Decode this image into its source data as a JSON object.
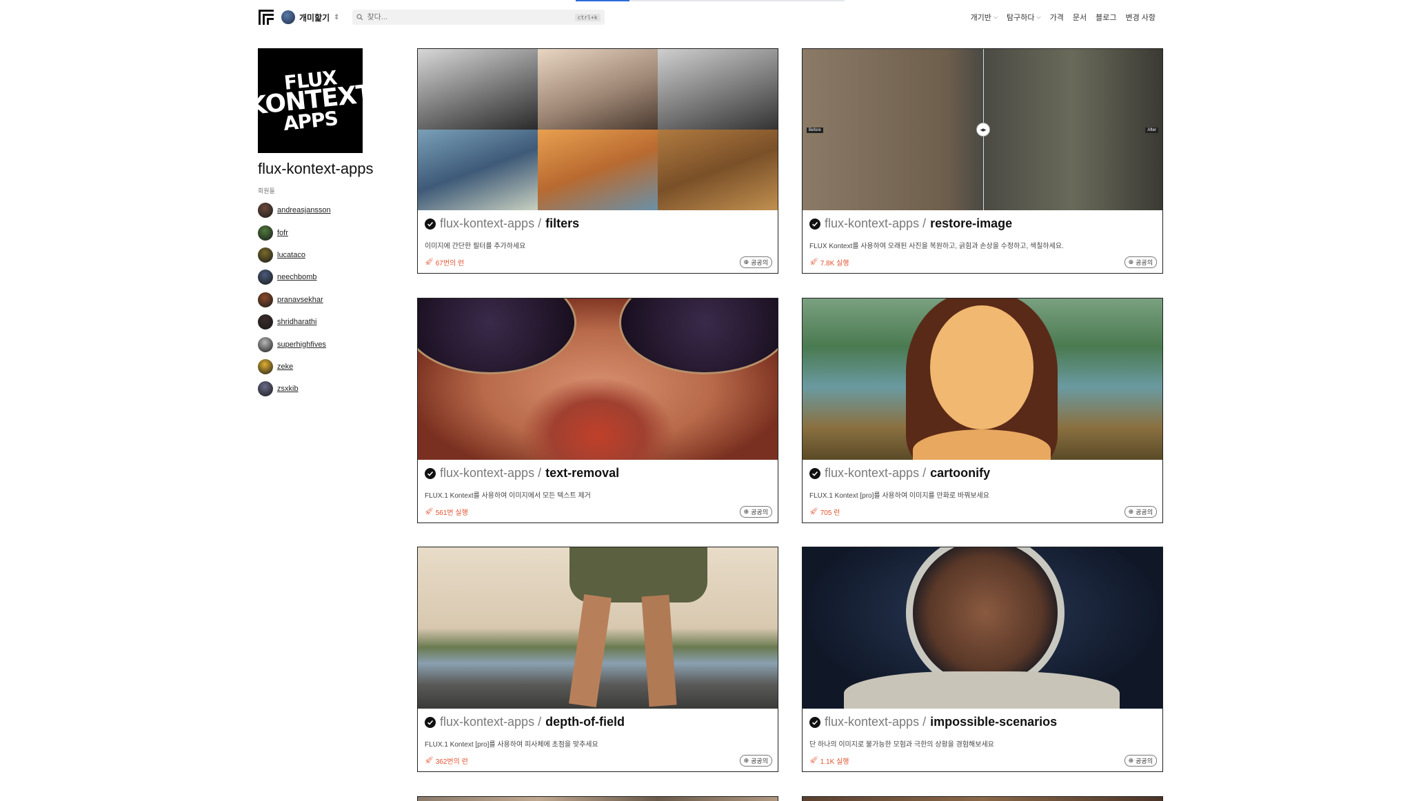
{
  "header": {
    "account_name": "개미핥기",
    "search_placeholder": "찾다...",
    "search_shortcut": "ctrl+k",
    "nav": [
      {
        "label": "개기반",
        "has_dropdown": true
      },
      {
        "label": "탐구하다",
        "has_dropdown": true
      },
      {
        "label": "가격",
        "has_dropdown": false
      },
      {
        "label": "문서",
        "has_dropdown": false
      },
      {
        "label": "블로그",
        "has_dropdown": false
      },
      {
        "label": "변경 사항",
        "has_dropdown": false
      }
    ]
  },
  "sidebar": {
    "logo_lines": [
      "FLUX",
      "KONTEXT",
      "APPS"
    ],
    "org_name": "flux-kontext-apps",
    "members_label": "회원들",
    "members": [
      {
        "name": "andreasjansson",
        "color": "#6b4a3a"
      },
      {
        "name": "fofr",
        "color": "#4f7a3c"
      },
      {
        "name": "lucataco",
        "color": "#7a6a2a"
      },
      {
        "name": "neechbomb",
        "color": "#4a5a7a"
      },
      {
        "name": "pranavsekhar",
        "color": "#8a4a2a"
      },
      {
        "name": "shridharathi",
        "color": "#3a2a2a"
      },
      {
        "name": "superhighfives",
        "color": "#b8b8b8"
      },
      {
        "name": "zeke",
        "color": "#e0b030"
      },
      {
        "name": "zsxkib",
        "color": "#6a6a8a"
      }
    ]
  },
  "cards": [
    {
      "owner": "flux-kontext-apps /",
      "slug": "filters",
      "description": "이미지에 간단한 필터를 추가하세요",
      "runs": "67번의 런",
      "visibility": "공공의"
    },
    {
      "owner": "flux-kontext-apps /",
      "slug": "restore-image",
      "description": "FLUX Kontext를 사용하여 오래된 사진을 복원하고, 긁힘과 손상을 수정하고, 색칠하세요.",
      "runs": "7.8K 실행",
      "visibility": "공공의",
      "before_label": "Before",
      "after_label": "After"
    },
    {
      "owner": "flux-kontext-apps /",
      "slug": "text-removal",
      "description": "FLUX.1 Kontext를 사용하여 이미지에서 모든 텍스트 제거",
      "runs": "561번 실행",
      "visibility": "공공의"
    },
    {
      "owner": "flux-kontext-apps /",
      "slug": "cartoonify",
      "description": "FLUX.1 Kontext [pro]를 사용하여 이미지를 만화로 바꿔보세요",
      "runs": "705 런",
      "visibility": "공공의"
    },
    {
      "owner": "flux-kontext-apps /",
      "slug": "depth-of-field",
      "description": "FLUX.1 Kontext [pro]를 사용하여 피사체에 초점을 맞추세요",
      "runs": "362번의 런",
      "visibility": "공공의"
    },
    {
      "owner": "flux-kontext-apps /",
      "slug": "impossible-scenarios",
      "description": "단 하나의 이미지로 불가능한 모험과 극한의 상황을 경험해보세요",
      "runs": "1.1K 실행",
      "visibility": "공공의"
    }
  ],
  "colors": {
    "accent_runs": "#e0522f",
    "card_border": "#202020",
    "progress": "#2b6cd8"
  }
}
